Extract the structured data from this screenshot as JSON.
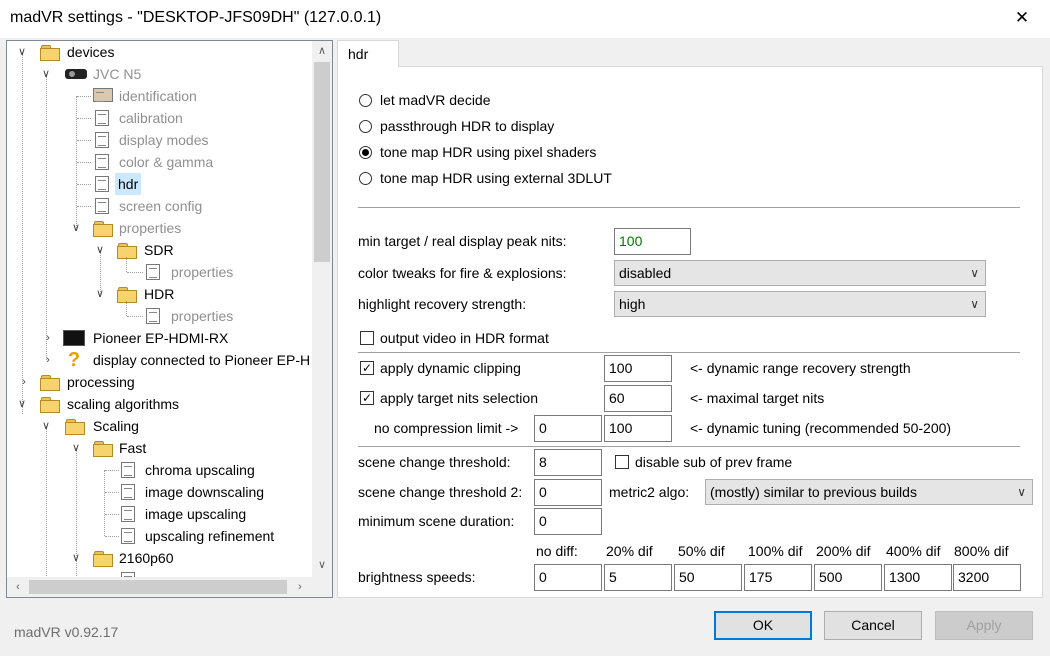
{
  "window": {
    "title": "madVR settings - \"DESKTOP-JFS09DH\" (127.0.0.1)",
    "close_glyph": "✕"
  },
  "tree": {
    "items": [
      {
        "label": "devices"
      },
      {
        "label": "JVC N5"
      },
      {
        "label": "identification"
      },
      {
        "label": "calibration"
      },
      {
        "label": "display modes"
      },
      {
        "label": "color & gamma"
      },
      {
        "label": "hdr"
      },
      {
        "label": "screen config"
      },
      {
        "label": "properties"
      },
      {
        "label": "SDR"
      },
      {
        "label": "properties"
      },
      {
        "label": "HDR"
      },
      {
        "label": "properties"
      },
      {
        "label": "Pioneer EP-HDMI-RX"
      },
      {
        "label": "display connected to Pioneer EP-H"
      },
      {
        "label": "processing"
      },
      {
        "label": "scaling algorithms"
      },
      {
        "label": "Scaling"
      },
      {
        "label": "Fast"
      },
      {
        "label": "chroma upscaling"
      },
      {
        "label": "image downscaling"
      },
      {
        "label": "image upscaling"
      },
      {
        "label": "upscaling refinement"
      },
      {
        "label": "2160p60"
      }
    ]
  },
  "tab": {
    "label": "hdr"
  },
  "hdr": {
    "radios": [
      {
        "label": "let madVR decide",
        "selected": false
      },
      {
        "label": "passthrough HDR to display",
        "selected": false
      },
      {
        "label": "tone map HDR using pixel shaders",
        "selected": true
      },
      {
        "label": "tone map HDR using external 3DLUT",
        "selected": false
      }
    ],
    "min_target": {
      "label": "min target / real display peak nits:",
      "value": "100",
      "value_color": "#007a00"
    },
    "color_tweaks": {
      "label": "color tweaks for fire & explosions:",
      "value": "disabled"
    },
    "highlight": {
      "label": "highlight recovery strength:",
      "value": "high"
    },
    "output_hdr": {
      "label": "output video in HDR format",
      "checked": false
    },
    "dyn_clip": {
      "label": "apply dynamic clipping",
      "checked": true,
      "value": "100",
      "note": "<- dynamic range recovery strength"
    },
    "target_nits": {
      "label": "apply target nits selection",
      "checked": true,
      "value": "60",
      "note": "<- maximal target nits"
    },
    "no_comp": {
      "label": "no compression limit ->",
      "value1": "0",
      "value2": "100",
      "note": "<- dynamic tuning (recommended 50-200)"
    },
    "scene_thr": {
      "label": "scene change threshold:",
      "value": "8",
      "checkbox_label": "disable sub of prev frame",
      "checked": false
    },
    "scene_thr2": {
      "label": "scene change threshold 2:",
      "value": "0",
      "algo_label": "metric2 algo:",
      "algo_value": "(mostly) similar to previous builds"
    },
    "min_scene": {
      "label": "minimum scene duration:",
      "value": "0"
    },
    "brightness": {
      "label": "brightness speeds:",
      "columns": [
        {
          "header": "no diff:",
          "value": "0"
        },
        {
          "header": "20% dif",
          "value": "5"
        },
        {
          "header": "50% dif",
          "value": "50"
        },
        {
          "header": "100% dif",
          "value": "175"
        },
        {
          "header": "200% dif",
          "value": "500"
        },
        {
          "header": "400% dif",
          "value": "1300"
        },
        {
          "header": "800% dif",
          "value": "3200"
        }
      ]
    }
  },
  "footer": {
    "version": "madVR v0.92.17",
    "ok": "OK",
    "cancel": "Cancel",
    "apply": "Apply"
  },
  "colors": {
    "selection": "#cce8ff",
    "default_button_border": "#0078d7"
  }
}
